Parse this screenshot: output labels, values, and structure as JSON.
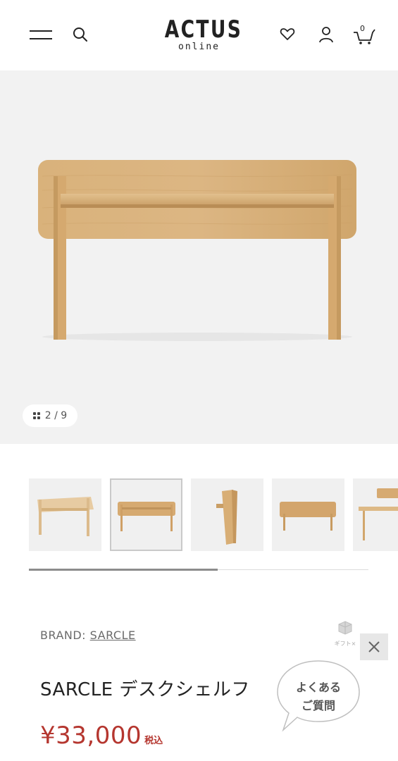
{
  "header": {
    "logo_main": "ACTUS",
    "logo_sub": "online",
    "cart_count": "0"
  },
  "gallery": {
    "counter": "2 / 9",
    "current_index": 2,
    "total": 9,
    "thumbnails": [
      "1",
      "2",
      "3",
      "4",
      "5"
    ]
  },
  "product": {
    "brand_label": "BRAND:",
    "brand_name": "SARCLE",
    "gift_label": "ギフト×",
    "title": "SARCLE デスクシェルフ",
    "price": "¥33,000",
    "tax_label": "税込"
  },
  "faq": {
    "line1": "よくある",
    "line2": "ご質問"
  },
  "colors": {
    "price": "#b5362f",
    "wood": "#d7ad75",
    "background": "#f2f2f2"
  }
}
